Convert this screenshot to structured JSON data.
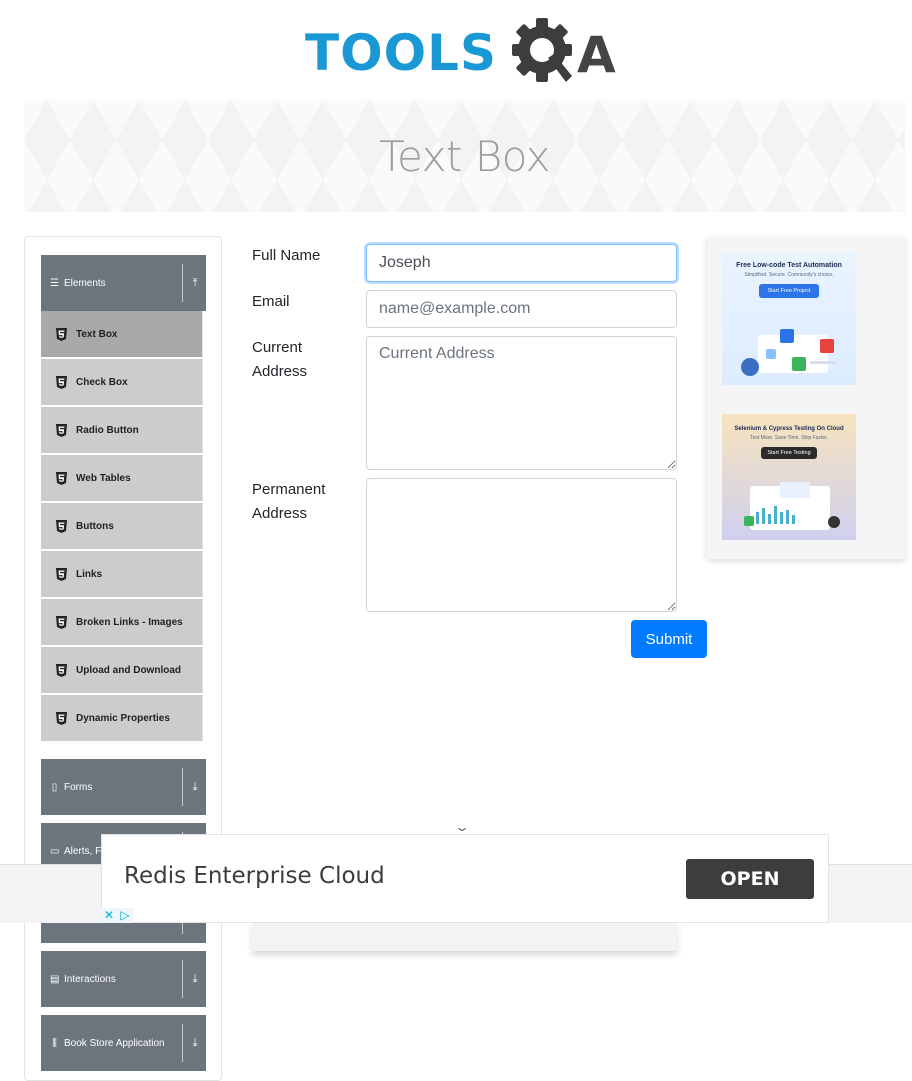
{
  "logo": {
    "text": "TOOLS",
    "suffix": "A"
  },
  "page_title": "Text Box",
  "sidebar": {
    "groups": [
      {
        "label": "Elements",
        "icon": "hamburger-icon",
        "expanded": true
      },
      {
        "label": "Forms",
        "icon": "document-icon",
        "expanded": false
      },
      {
        "label": "Alerts, Fr",
        "icon": "window-icon",
        "expanded": false
      },
      {
        "label": "Interactions",
        "icon": "list-icon",
        "expanded": false
      },
      {
        "label": "Book Store Application",
        "icon": "books-icon",
        "expanded": false
      }
    ],
    "items": [
      {
        "label": "Text Box",
        "active": true
      },
      {
        "label": "Check Box",
        "active": false
      },
      {
        "label": "Radio Button",
        "active": false
      },
      {
        "label": "Web Tables",
        "active": false
      },
      {
        "label": "Buttons",
        "active": false
      },
      {
        "label": "Links",
        "active": false
      },
      {
        "label": "Broken Links - Images",
        "active": false
      },
      {
        "label": "Upload and Download",
        "active": false
      },
      {
        "label": "Dynamic Properties",
        "active": false
      }
    ]
  },
  "form": {
    "full_name_label": "Full Name",
    "full_name_value": "Joseph",
    "email_label": "Email",
    "email_placeholder": "name@example.com",
    "current_address_label_1": "Current",
    "current_address_label_2": "Address",
    "current_address_placeholder": "Current Address",
    "permanent_address_label_1": "Permanent",
    "permanent_address_label_2": "Address",
    "submit_label": "Submit"
  },
  "right_ads": {
    "ad1": {
      "title": "Free Low-code Test Automation",
      "subtitle": "Simplified. Secure. Community's choice.",
      "button": "Start Free Project"
    },
    "ad2": {
      "title": "Selenium & Cypress Testing On Cloud",
      "subtitle": "Test More. Save Time. Ship Faster.",
      "button": "Start Free Testing"
    }
  },
  "bottom_ad": {
    "text": "Redis Enterprise Cloud",
    "button": "OPEN"
  },
  "colors": {
    "brand_blue": "#1a98d5",
    "sidebar_header": "#6c757d",
    "menu_item": "#cccccc",
    "menu_active": "#a9a9a9",
    "submit": "#007bff"
  }
}
